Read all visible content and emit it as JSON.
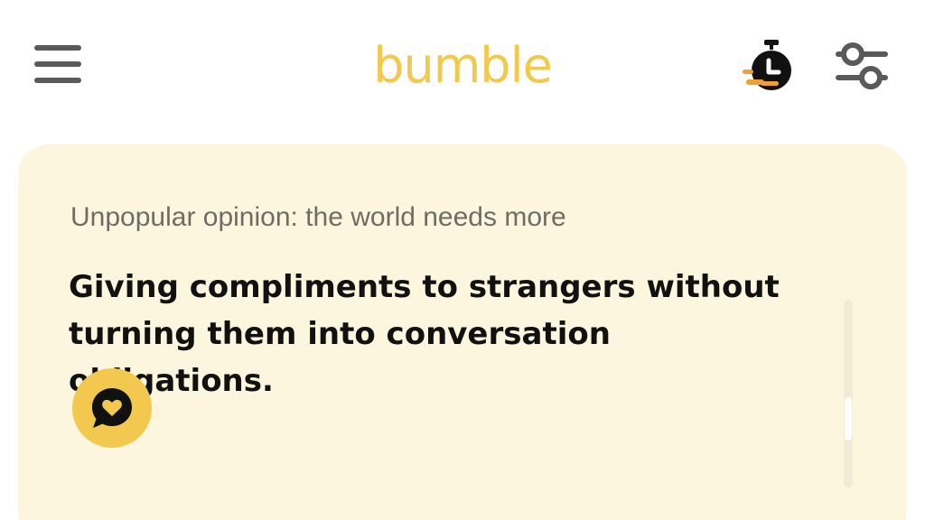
{
  "header": {
    "brand": "bumble",
    "icons": {
      "menu": "hamburger-menu-icon",
      "timer": "stopwatch-icon",
      "filter": "sliders-filter-icon"
    }
  },
  "card": {
    "prompt": "Unpopular opinion: the world needs more",
    "answer": "Giving compliments to strangers without turning them into conversation obligations.",
    "action_icon": "heart-chat-bubble-icon"
  },
  "colors": {
    "brand_yellow": "#f2c94c",
    "card_background": "#fdf6de",
    "timer_accent": "#f0a030",
    "icon_gray": "#5a5a5a"
  }
}
